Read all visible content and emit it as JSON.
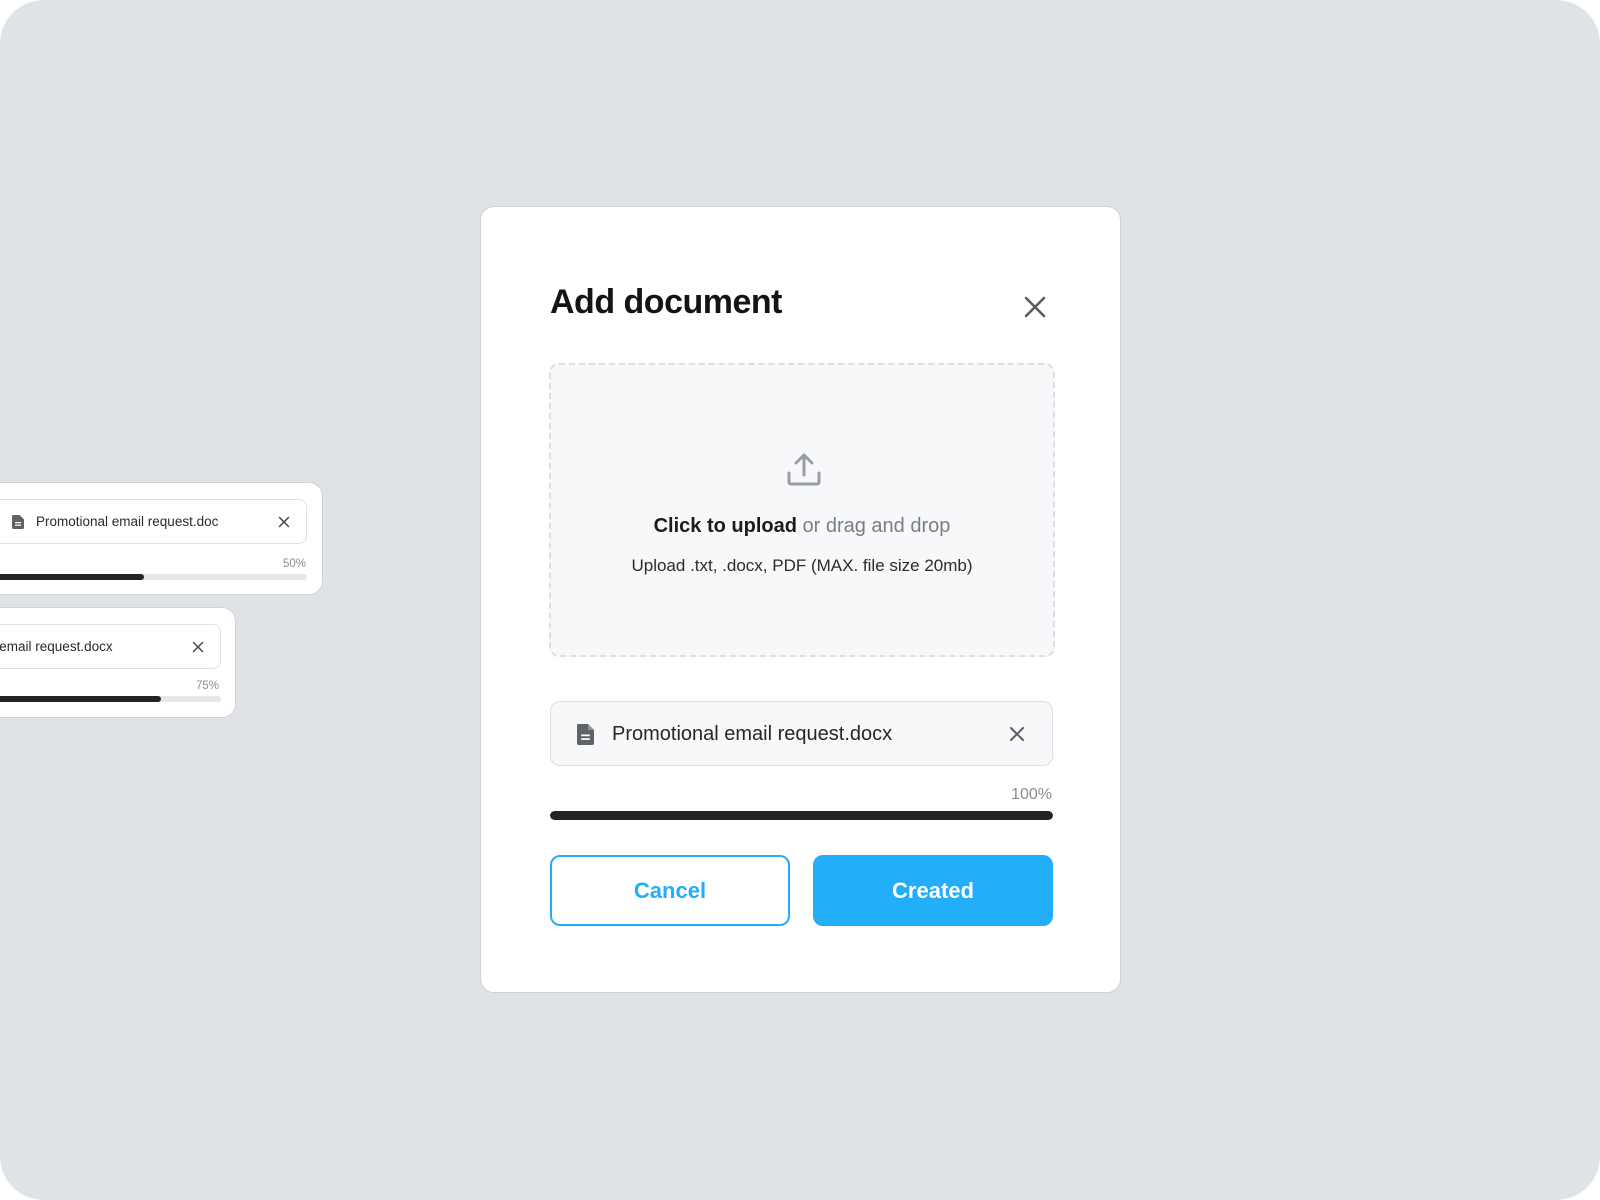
{
  "colors": {
    "accent": "#22aef8",
    "background": "#dfe2e7",
    "progress_fill": "#222326"
  },
  "side_cards": [
    {
      "file_name": "Promotional email request.doc",
      "progress": 0.5,
      "progress_label": "50%",
      "icon": "document-icon",
      "close_icon": "close-icon"
    },
    {
      "file_name": "onal email request.docx",
      "progress": 0.75,
      "progress_label": "75%",
      "icon": "document-icon",
      "close_icon": "close-icon"
    }
  ],
  "modal": {
    "title": "Add document",
    "close_icon": "close-icon",
    "dropzone": {
      "icon": "upload-icon",
      "primary_bold": "Click to upload",
      "primary_rest": " or drag and drop",
      "hint": "Upload .txt, .docx, PDF (MAX. file size 20mb)"
    },
    "file": {
      "name": "Promotional email request.docx",
      "icon": "document-icon",
      "remove_icon": "close-icon"
    },
    "progress": {
      "value": 1.0,
      "label": "100%"
    },
    "buttons": {
      "cancel": "Cancel",
      "created": "Created"
    }
  }
}
